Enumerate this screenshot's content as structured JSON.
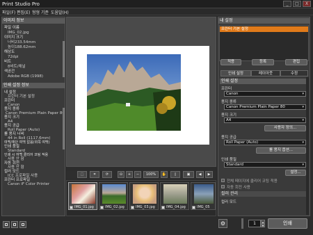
{
  "window": {
    "title": "Print Studio Pro",
    "controls": [
      "_",
      "□",
      "X"
    ]
  },
  "menu": [
    "파일(F)",
    "편집(E)",
    "형형 기준",
    "도움말(H)"
  ],
  "left": {
    "image_info_title": "이미지 정보",
    "image_info": [
      {
        "k": "파일 이름",
        "v": "IMG_02.jpg"
      },
      {
        "k": "이미지 크기",
        "v": "너비233.54mm"
      },
      {
        "k": "",
        "v": "높이188.62mm"
      },
      {
        "k": "해상도",
        "v": "72dpi"
      },
      {
        "k": "비트",
        "v": "8비트/채널"
      },
      {
        "k": "색공간",
        "v": "Adobe RGB (1998)"
      }
    ],
    "print_info_title": "인쇄 설정 정보",
    "print_info": [
      {
        "k": "내 설정",
        "v": "프린터 기본 설정"
      },
      {
        "k": "프린터",
        "v": "Canon"
      },
      {
        "k": "용지 종류",
        "v": "Canon Premium Plain Paper 80"
      },
      {
        "k": "용지 크기",
        "v": "A4"
      },
      {
        "k": "용지 공급",
        "v": "Roll Paper (Auto)"
      },
      {
        "k": "롤 용지 너비",
        "v": "44 in Roll (1117.6mm)"
      },
      {
        "k": "여백/재단 여백 없음(위쪽 여백)",
        "v": ""
      },
      {
        "k": "인쇄 품질",
        "v": "Standard"
      },
      {
        "k": "인쇄 시 여백 클리어 코팅 적용",
        "v": "사용 안 함"
      },
      {
        "k": "자동 회전",
        "v": "사용 안 함"
      },
      {
        "k": "컬러 모드",
        "v": "ICC 프로파일 사용"
      },
      {
        "k": "프린터 프로파일",
        "v": "Canon iF Color Printer"
      }
    ]
  },
  "toolbar": {
    "zoom": "100%"
  },
  "thumbnails": [
    {
      "name": "IMG_01.jpg",
      "checked": true
    },
    {
      "name": "IMG_02.jpg",
      "checked": true
    },
    {
      "name": "IMG_03.jpg",
      "checked": true
    },
    {
      "name": "IMG_04.jpg",
      "checked": true
    },
    {
      "name": "IMG_05",
      "checked": true
    }
  ],
  "right": {
    "my_settings_title": "내 설정",
    "my_settings_item": "프린터 기본 설정",
    "btn_apply": "적용",
    "btn_register": "등록",
    "btn_edit": "편집",
    "tabs": [
      "인쇄 설정",
      "레이아웃",
      "수정"
    ],
    "print_settings_head": "인쇄 설정",
    "printer_label": "프린터",
    "printer_value": "Canon",
    "media_type_label": "용지 종류",
    "media_type_value": "Canon Premium Plain Paper 80",
    "paper_size_label": "용지 크기",
    "paper_size_value": "A4",
    "custom_btn": "사용자 정의...",
    "paper_source_label": "용지 공급",
    "paper_source_value": "Roll Paper (Auto)",
    "roll_btn": "롤 용지 옵션...",
    "quality_label": "인쇄 품질",
    "quality_value": "Standard",
    "settings_btn": "설정...",
    "chk1": "전체 페이지에 클리어 코팅 적용",
    "chk2": "자동 회전 사용",
    "color_mgmt_head": "컬러 관리",
    "color_mode_label": "컬러 모드"
  },
  "bottom": {
    "copies": "1",
    "print_btn": "인쇄"
  }
}
